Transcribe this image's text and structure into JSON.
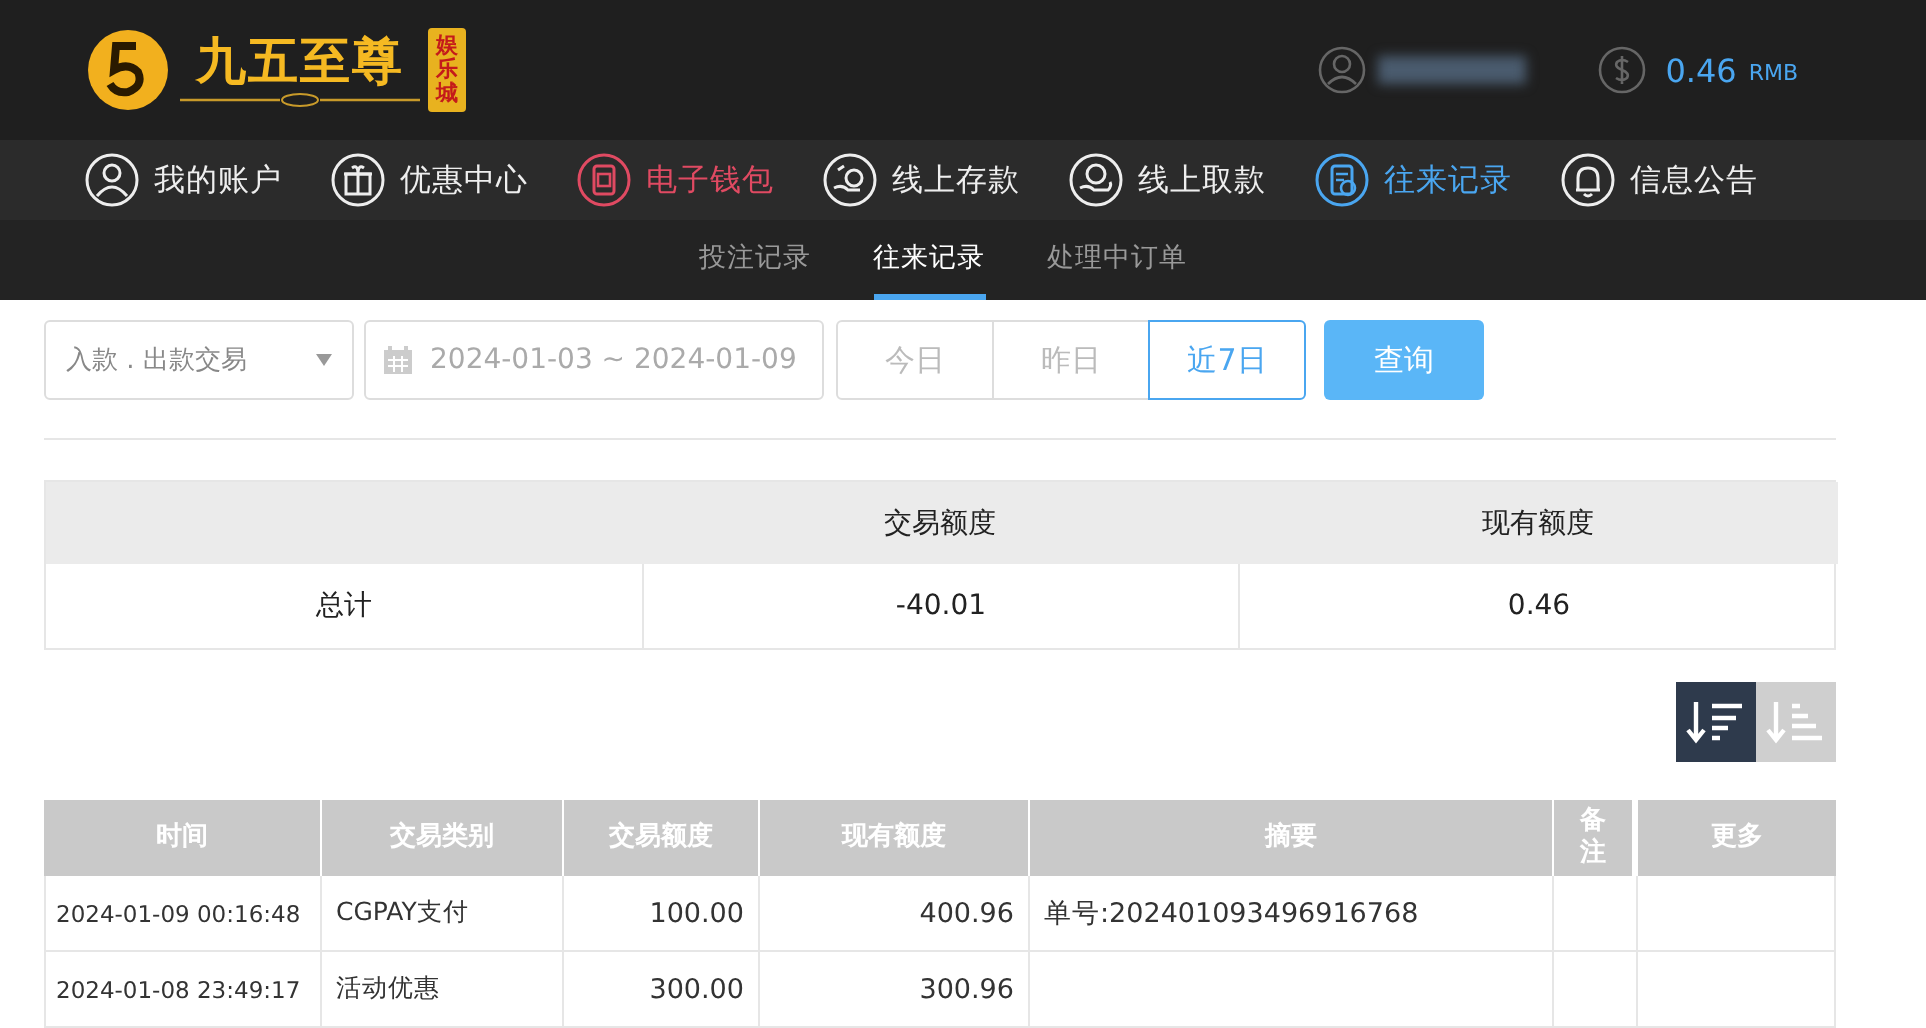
{
  "header": {
    "logo": {
      "title": "九五至尊",
      "badge": "娱乐城"
    },
    "balance": {
      "amount": "0.46",
      "unit": "RMB"
    }
  },
  "nav": [
    {
      "label": "我的账户",
      "kind": "user",
      "selected": false,
      "highlighted": false
    },
    {
      "label": "优惠中心",
      "kind": "gift",
      "selected": false,
      "highlighted": false
    },
    {
      "label": "电子钱包",
      "kind": "wallet",
      "selected": false,
      "highlighted": true
    },
    {
      "label": "线上存款",
      "kind": "deposit",
      "selected": false,
      "highlighted": false
    },
    {
      "label": "线上取款",
      "kind": "withdraw",
      "selected": false,
      "highlighted": false
    },
    {
      "label": "往来记录",
      "kind": "record",
      "selected": true,
      "highlighted": false
    },
    {
      "label": "信息公告",
      "kind": "bell",
      "selected": false,
      "highlighted": false
    }
  ],
  "subtabs": [
    {
      "label": "投注记录",
      "selected": false
    },
    {
      "label": "往来记录",
      "selected": true
    },
    {
      "label": "处理中订单",
      "selected": false
    }
  ],
  "filters": {
    "type": "入款 . 出款交易",
    "date_range": "2024-01-03 ~ 2024-01-09",
    "quick_ranges": [
      {
        "label": "今日",
        "selected": false
      },
      {
        "label": "昨日",
        "selected": false
      },
      {
        "label": "近7日",
        "selected": true
      }
    ],
    "query_button": "查询"
  },
  "summary": {
    "columns": [
      "交易额度",
      "现有额度"
    ],
    "row": {
      "label": "总计",
      "values": [
        "-40.01",
        "0.46"
      ]
    }
  },
  "sort": [
    {
      "kind": "desc",
      "selected": true
    },
    {
      "kind": "asc",
      "selected": false
    }
  ],
  "table": {
    "columns": [
      "时间",
      "交易类别",
      "交易额度",
      "现有额度",
      "摘要",
      "备注",
      "更多"
    ],
    "rows": [
      [
        "2024-01-09 00:16:48",
        "CGPAY支付",
        "100.00",
        "400.96",
        "单号:202401093496916768",
        "",
        ""
      ],
      [
        "2024-01-08 23:49:17",
        "活动优惠",
        "300.00",
        "300.96",
        "",
        "",
        ""
      ]
    ]
  }
}
